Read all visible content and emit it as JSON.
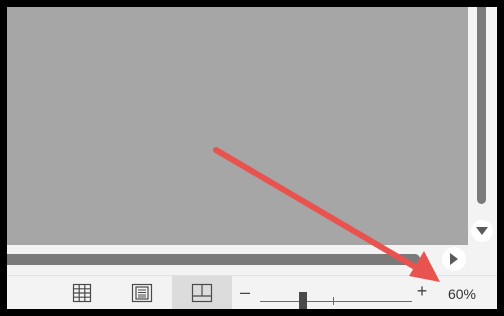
{
  "statusbar": {
    "view_buttons": [
      {
        "name": "normal-view",
        "icon": "grid-icon",
        "active": false
      },
      {
        "name": "page-layout-view",
        "icon": "page-layout-icon",
        "active": false
      },
      {
        "name": "page-break-preview",
        "icon": "page-break-preview-icon",
        "active": true
      }
    ],
    "zoom": {
      "minus_label": "–",
      "plus_label": "+",
      "level_text": "60%"
    }
  },
  "scrollbars": {
    "vertical_button_icon": "triangle-down-icon",
    "horizontal_button_icon": "triangle-right-icon"
  },
  "annotation": {
    "type": "arrow",
    "color": "#e9534f",
    "points_to": "zoom-level"
  },
  "colors": {
    "sheet_background": "#a6a6a6",
    "chrome": "#f3f3f3",
    "scrollbar_thumb": "#7a7a7a",
    "frame_border": "#000000"
  }
}
